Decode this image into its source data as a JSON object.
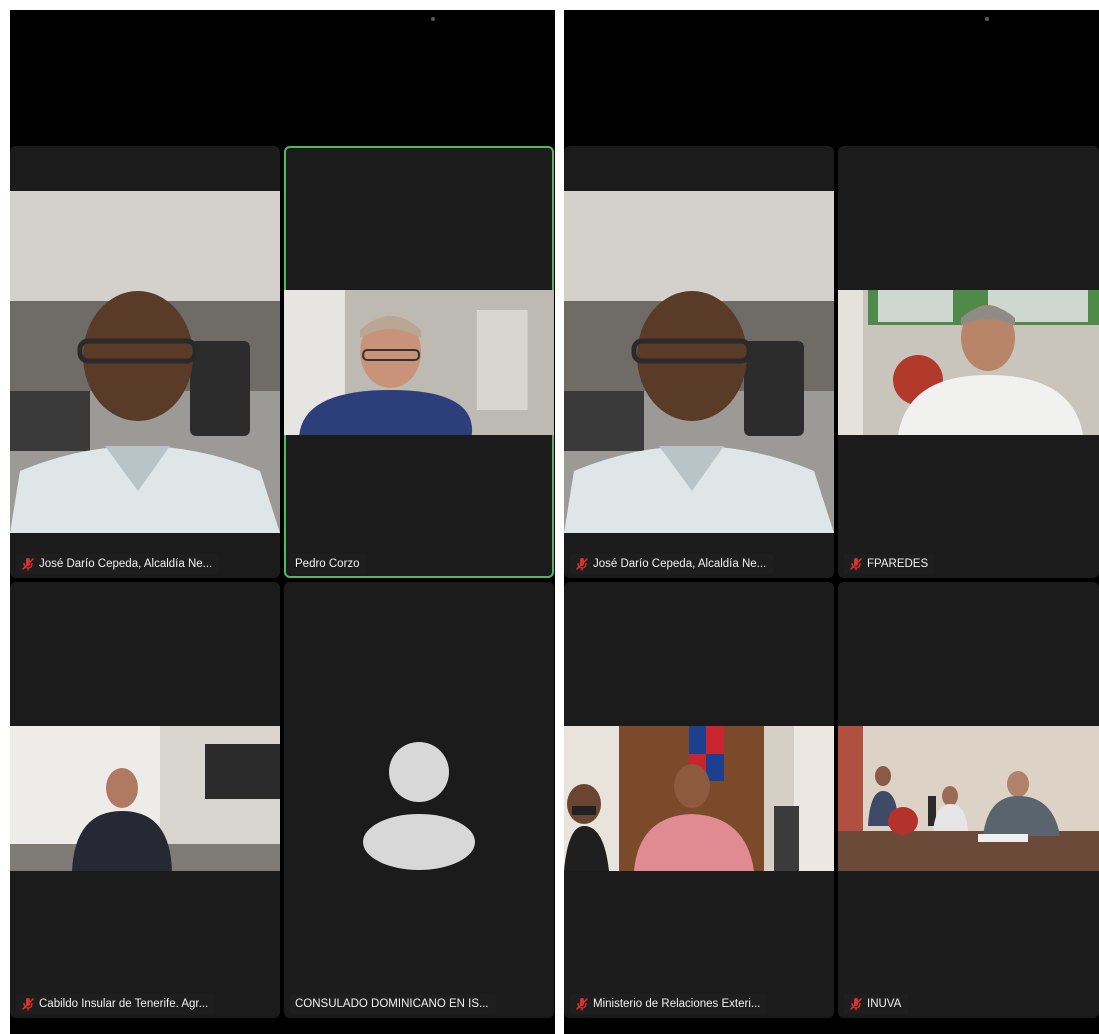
{
  "colors": {
    "background": "#000000",
    "tile_bg": "#1b1b1b",
    "active_speaker_border": "#53b85a",
    "mic_muted": "#d9322b",
    "label_bg": "#1e1e1e",
    "label_text": "#f2f2f2",
    "avatar_placeholder": "#d8d8d8"
  },
  "screens": [
    {
      "tiles": [
        {
          "name": "José Darío Cepeda, Alcaldía Ne...",
          "muted": true,
          "active": false,
          "video": "person-in-car"
        },
        {
          "name": "Pedro Corzo",
          "muted": false,
          "active": true,
          "video": "person-in-office"
        },
        {
          "name": "Cabildo Insular de Tenerife. Agr...",
          "muted": true,
          "active": false,
          "video": "conference-room"
        },
        {
          "name": "CONSULADO DOMINICANO EN IS...",
          "muted": false,
          "active": false,
          "video": "avatar-placeholder"
        }
      ]
    },
    {
      "tiles": [
        {
          "name": "José Darío Cepeda, Alcaldía Ne...",
          "muted": true,
          "active": false,
          "video": "person-in-car"
        },
        {
          "name": "FPAREDES",
          "muted": true,
          "active": false,
          "video": "person-in-office"
        },
        {
          "name": "Ministerio de Relaciones Exteri...",
          "muted": true,
          "active": false,
          "video": "official-with-flag"
        },
        {
          "name": "INUVA",
          "muted": true,
          "active": false,
          "video": "meeting-table"
        }
      ]
    }
  ]
}
